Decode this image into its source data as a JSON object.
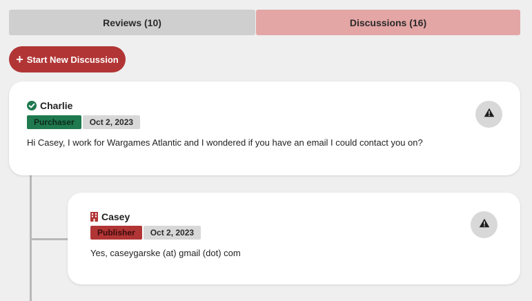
{
  "tabs": {
    "reviews_label": "Reviews (10)",
    "discussions_label": "Discussions (16)"
  },
  "actions": {
    "new_discussion_label": "Start New Discussion",
    "new_discussion_icon": "plus-icon"
  },
  "colors": {
    "accent": "#b23535",
    "active_tab": "#e4a5a5",
    "purchaser": "#1f7a4f",
    "publisher": "#b23535"
  },
  "discussion": [
    {
      "author": "Charlie",
      "author_icon": "verified-check-icon",
      "role": "Purchaser",
      "date": "Oct 2, 2023",
      "message": "Hi Casey, I work for Wargames Atlantic and I wondered if you have an email I could contact you on?",
      "report_icon": "warning-icon"
    },
    {
      "author": "Casey",
      "author_icon": "building-icon",
      "role": "Publisher",
      "date": "Oct 2, 2023",
      "message": "Yes, caseygarske (at) gmail (dot) com",
      "report_icon": "warning-icon"
    }
  ]
}
